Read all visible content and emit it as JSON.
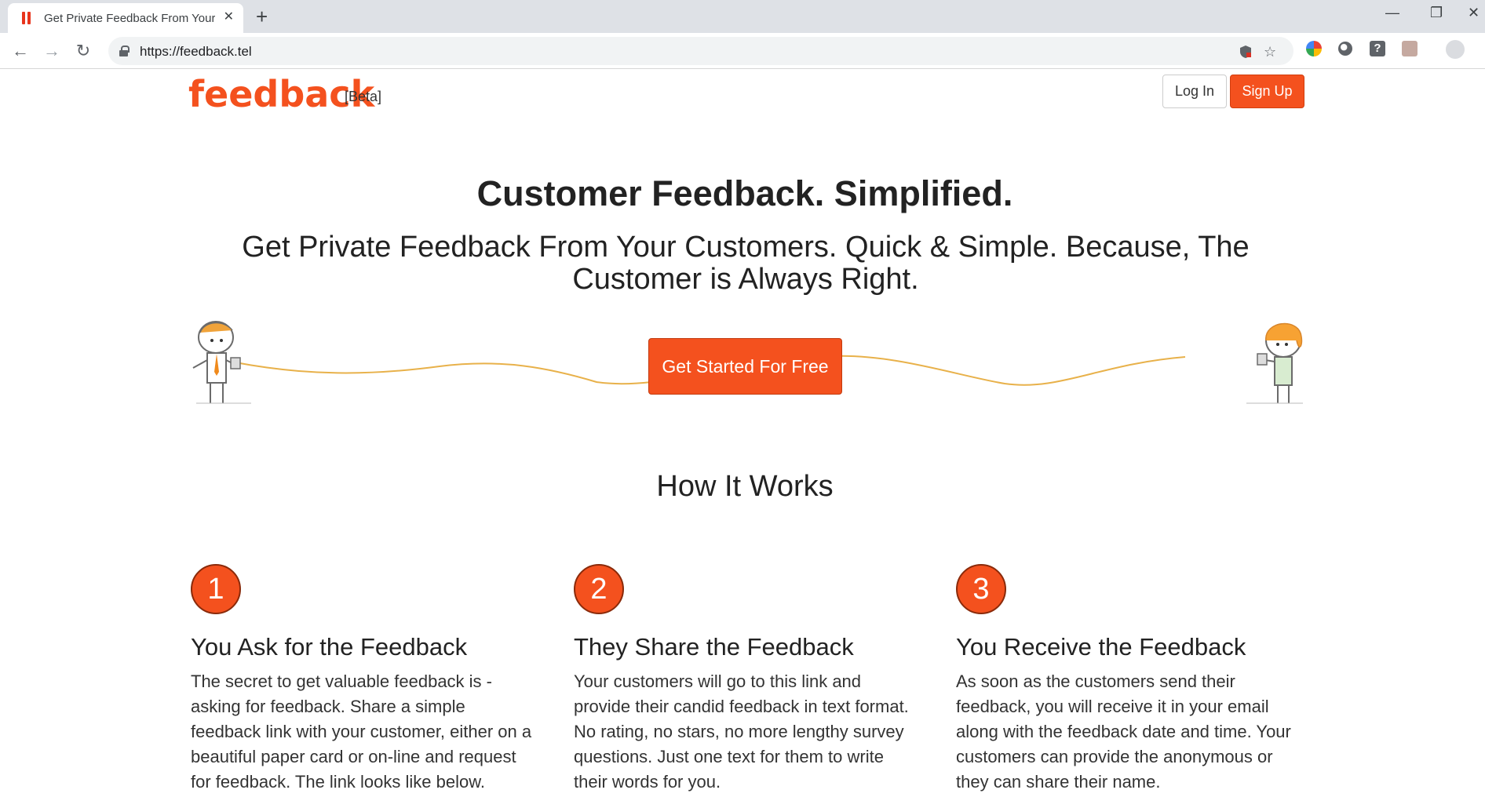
{
  "browser": {
    "tab_title": "Get Private Feedback From Your Customers",
    "tab_close": "✕",
    "new_tab": "+",
    "url": "https://feedback.tel",
    "back": "←",
    "forward": "→",
    "reload": "↻",
    "minimize": "—",
    "restore": "❐",
    "close": "✕",
    "star": "☆",
    "menu": "⋮"
  },
  "header": {
    "logo": "feedback",
    "beta": "[Beta]",
    "login_label": "Log In",
    "signup_label": "Sign Up"
  },
  "hero": {
    "title": "Customer Feedback. Simplified.",
    "subtitle": "Get Private Feedback From Your Customers. Quick & Simple. Because, The Customer is Always Right.",
    "cta_label": "Get Started For Free"
  },
  "how": {
    "title": "How It Works",
    "steps": [
      {
        "number": "1",
        "title": "You Ask for the Feedback",
        "text": "The secret to get valuable feedback is - asking for feedback. Share a simple feedback link with your customer, either on a beautiful paper card or on-line and request for feedback. The link looks like below."
      },
      {
        "number": "2",
        "title": "They Share the Feedback",
        "text": "Your customers will go to this link and provide their candid feedback in text format. No rating, no stars, no more lengthy survey questions. Just one text for them to write their words for you."
      },
      {
        "number": "3",
        "title": "You Receive the Feedback",
        "text": "As soon as the customers send their feedback, you will receive it in your email along with the feedback date and time. Your customers can provide the anonymous or they can share their name."
      }
    ]
  },
  "colors": {
    "brand": "#f4511e",
    "text": "#222222"
  }
}
